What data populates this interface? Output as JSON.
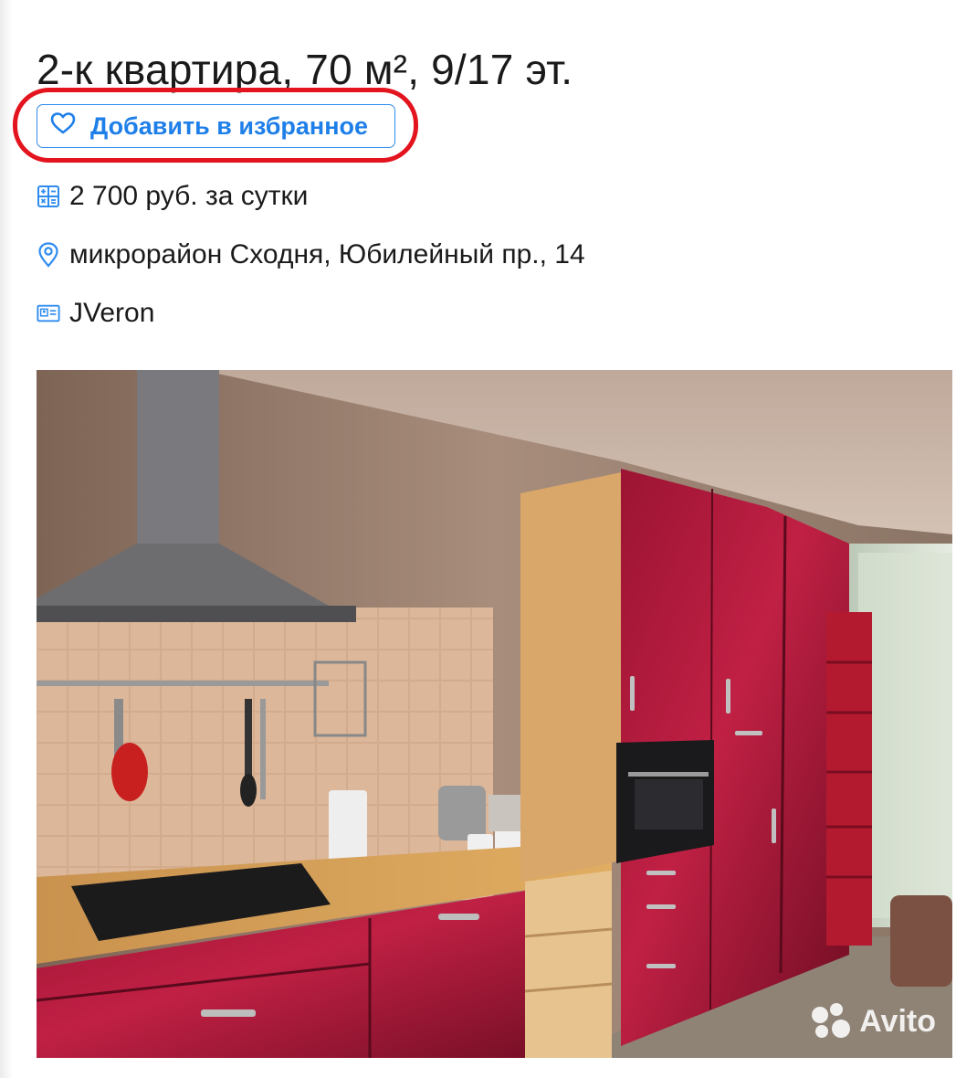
{
  "listing": {
    "title": "2-к квартира, 70 м², 9/17 эт.",
    "favorite_label": "Добавить в избранное",
    "price": "2 700 руб. за сутки",
    "address": "микрорайон Сходня, Юбилейный пр., 14",
    "seller": "JVeron"
  },
  "photo": {
    "watermark": "Avito"
  },
  "icons": {
    "favorite": "heart-icon",
    "price": "calculator-icon",
    "address": "map-pin-icon",
    "seller": "id-card-icon",
    "watermark": "avito-logo-icon"
  },
  "colors": {
    "accent": "#1f7fe8",
    "highlight": "#e3141e",
    "text": "#1a1a1a"
  }
}
